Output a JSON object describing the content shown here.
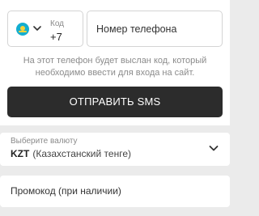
{
  "phone_form": {
    "country_flag_icon": "kazakhstan-flag-icon",
    "code_label": "Код",
    "code_value": "+7",
    "phone_placeholder": "Номер телефона",
    "hint_line1": "На этот телефон будет выслан код, который",
    "hint_line2": "необходимо ввести для входа на сайт.",
    "send_sms_label": "ОТПРАВИТЬ SMS"
  },
  "currency": {
    "label": "Выберите валюту",
    "code": "KZT",
    "name": "(Казахстанский тенге)",
    "icon": "chevron-down-icon"
  },
  "promo": {
    "placeholder": "Промокод (при наличии)"
  },
  "colors": {
    "button_bg": "#2c2c2c",
    "page_bg": "#ebebeb",
    "field_border": "#d4d4d4",
    "hint_text": "#8b8b8b"
  }
}
